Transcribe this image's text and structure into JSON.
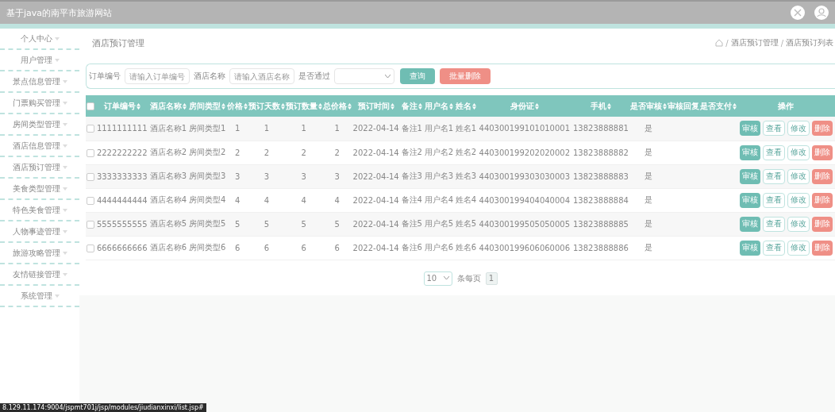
{
  "header": {
    "title": "基于java的南平市旅游网站"
  },
  "sidebar": {
    "items": [
      {
        "label": "个人中心"
      },
      {
        "label": "用户管理"
      },
      {
        "label": "景点信息管理"
      },
      {
        "label": "门票购买管理"
      },
      {
        "label": "房间类型管理"
      },
      {
        "label": "酒店信息管理"
      },
      {
        "label": "酒店预订管理"
      },
      {
        "label": "美食类型管理"
      },
      {
        "label": "特色美食管理"
      },
      {
        "label": "人物事迹管理"
      },
      {
        "label": "旅游攻略管理"
      },
      {
        "label": "友情链接管理"
      },
      {
        "label": "系统管理"
      }
    ]
  },
  "page_title": "酒店预订管理",
  "breadcrumb": [
    {
      "kind": "separator",
      "label": "/"
    },
    {
      "kind": "link",
      "label": "酒店预订管理"
    },
    {
      "kind": "separator",
      "label": "/"
    },
    {
      "kind": "link",
      "label": "酒店预订列表"
    }
  ],
  "search": {
    "fields": [
      {
        "kind": "input",
        "label": "订单编号",
        "placeholder": "请输入订单编号"
      },
      {
        "kind": "input",
        "label": "酒店名称",
        "placeholder": "请输入酒店名称"
      },
      {
        "kind": "select",
        "label": "是否通过"
      }
    ],
    "buttons": [
      {
        "kind": "primary",
        "label": "查询"
      },
      {
        "kind": "danger",
        "label": "批量删除"
      }
    ]
  },
  "table": {
    "select_all": {
      "checked": false
    },
    "columns": [
      {
        "label": "订单编号",
        "sortable": true
      },
      {
        "label": "酒店名称",
        "sortable": true
      },
      {
        "label": "房间类型",
        "sortable": true
      },
      {
        "label": "价格",
        "sortable": true
      },
      {
        "label": "预订天数",
        "sortable": true
      },
      {
        "label": "预订数量",
        "sortable": true
      },
      {
        "label": "总价格",
        "sortable": true
      },
      {
        "label": "预订时间",
        "sortable": true
      },
      {
        "label": "备注",
        "sortable": true
      },
      {
        "label": "用户名",
        "sortable": true
      },
      {
        "label": "姓名",
        "sortable": true
      },
      {
        "label": "身份证",
        "sortable": true
      },
      {
        "label": "手机",
        "sortable": true
      },
      {
        "label": "是否审核",
        "sortable": true
      },
      {
        "label": "审核回复",
        "sortable": false
      },
      {
        "label": "是否支付",
        "sortable": true
      },
      {
        "label": "操作",
        "sortable": false
      }
    ],
    "rows": [
      {
        "checked": false,
        "cells": [
          "1111111111",
          "酒店名称1",
          "房间类型1",
          "1",
          "1",
          "1",
          "1",
          "2022-04-14",
          "备注1",
          "用户名1",
          "姓名1",
          "440300199101010001",
          "13823888881",
          "是"
        ],
        "actions": [
          {
            "kind": "primary",
            "label": "审核"
          },
          {
            "kind": "outline",
            "label": "查看"
          },
          {
            "kind": "outline",
            "label": "修改"
          },
          {
            "kind": "danger",
            "label": "删除"
          }
        ]
      },
      {
        "checked": false,
        "cells": [
          "2222222222",
          "酒店名称2",
          "房间类型2",
          "2",
          "2",
          "2",
          "2",
          "2022-04-14",
          "备注2",
          "用户名2",
          "姓名2",
          "440300199202020002",
          "13823888882",
          "是"
        ],
        "actions": [
          {
            "kind": "primary",
            "label": "审核"
          },
          {
            "kind": "outline",
            "label": "查看"
          },
          {
            "kind": "outline",
            "label": "修改"
          },
          {
            "kind": "danger",
            "label": "删除"
          }
        ]
      },
      {
        "checked": false,
        "cells": [
          "3333333333",
          "酒店名称3",
          "房间类型3",
          "3",
          "3",
          "3",
          "3",
          "2022-04-14",
          "备注3",
          "用户名3",
          "姓名3",
          "440300199303030003",
          "13823888883",
          "是"
        ],
        "actions": [
          {
            "kind": "primary",
            "label": "审核"
          },
          {
            "kind": "outline",
            "label": "查看"
          },
          {
            "kind": "outline",
            "label": "修改"
          },
          {
            "kind": "danger",
            "label": "删除"
          }
        ]
      },
      {
        "checked": false,
        "cells": [
          "4444444444",
          "酒店名称4",
          "房间类型4",
          "4",
          "4",
          "4",
          "4",
          "2022-04-14",
          "备注4",
          "用户名4",
          "姓名4",
          "440300199404040004",
          "13823888884",
          "是"
        ],
        "actions": [
          {
            "kind": "primary",
            "label": "审核"
          },
          {
            "kind": "outline",
            "label": "查看"
          },
          {
            "kind": "outline",
            "label": "修改"
          },
          {
            "kind": "danger",
            "label": "删除"
          }
        ]
      },
      {
        "checked": false,
        "cells": [
          "5555555555",
          "酒店名称5",
          "房间类型5",
          "5",
          "5",
          "5",
          "5",
          "2022-04-14",
          "备注5",
          "用户名5",
          "姓名5",
          "440300199505050005",
          "13823888885",
          "是"
        ],
        "actions": [
          {
            "kind": "primary",
            "label": "审核"
          },
          {
            "kind": "outline",
            "label": "查看"
          },
          {
            "kind": "outline",
            "label": "修改"
          },
          {
            "kind": "danger",
            "label": "删除"
          }
        ]
      },
      {
        "checked": false,
        "cells": [
          "6666666666",
          "酒店名称6",
          "房间类型6",
          "6",
          "6",
          "6",
          "6",
          "2022-04-14",
          "备注6",
          "用户名6",
          "姓名6",
          "440300199606060006",
          "13823888886",
          "是"
        ],
        "actions": [
          {
            "kind": "primary",
            "label": "审核"
          },
          {
            "kind": "outline",
            "label": "查看"
          },
          {
            "kind": "outline",
            "label": "修改"
          },
          {
            "kind": "danger",
            "label": "删除"
          }
        ]
      }
    ]
  },
  "pagination": {
    "page_size": "10",
    "page_size_label": "条每页",
    "pages": [
      {
        "label": "1",
        "selected": true
      }
    ]
  },
  "status_url": "8.129.11.174:9004/jspmt701j/jsp/modules/jiudianxinxi/list.jsp#"
}
